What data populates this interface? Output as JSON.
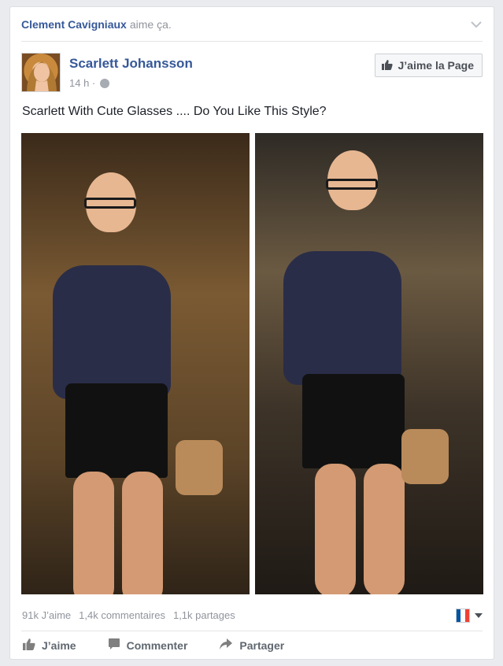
{
  "story": {
    "actor_name": "Clement Cavigniaux",
    "action_text": "aime ça."
  },
  "post": {
    "page_name": "Scarlett Johansson",
    "time": "14 h ·",
    "privacy_icon": "globe-icon",
    "like_page_label": "J’aime la Page",
    "text": "Scarlett With Cute Glasses .... Do You Like This Style?"
  },
  "stats": {
    "likes": "91k J’aime",
    "comments": "1,4k commentaires",
    "shares": "1,1k partages"
  },
  "actions": {
    "like": "J’aime",
    "comment": "Commenter",
    "share": "Partager"
  },
  "colors": {
    "link_blue": "#365899",
    "muted": "#90949c",
    "action_gray": "#606770"
  }
}
